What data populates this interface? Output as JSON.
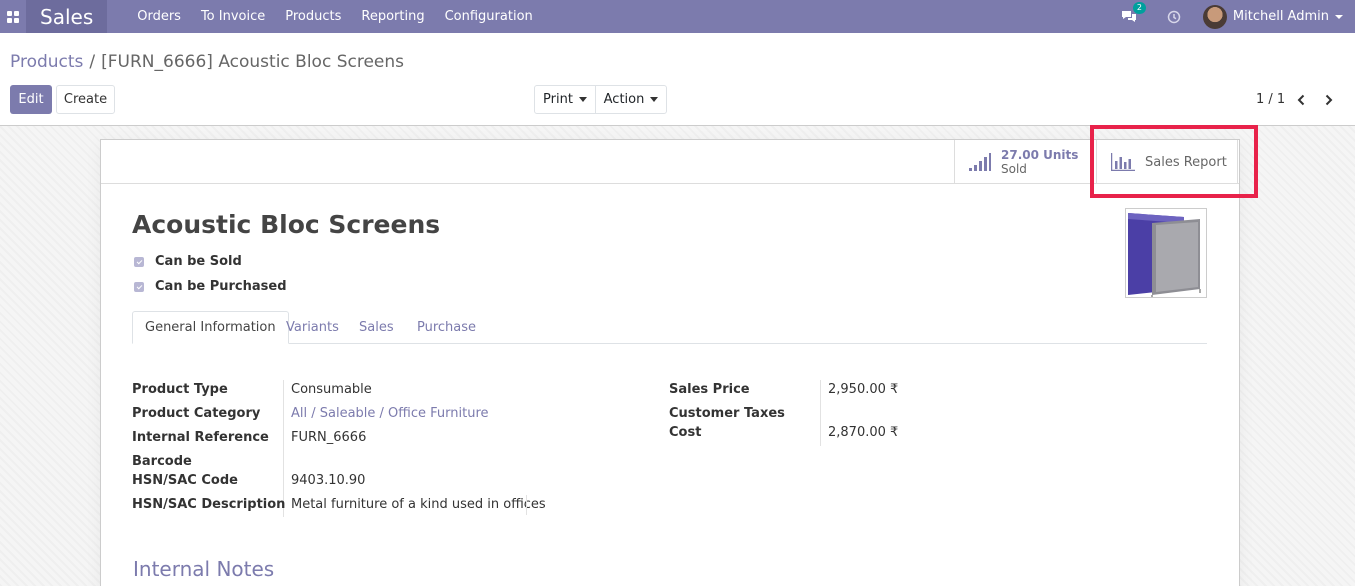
{
  "nav": {
    "brand": "Sales",
    "menu": [
      "Orders",
      "To Invoice",
      "Products",
      "Reporting",
      "Configuration"
    ],
    "chat_count": "2",
    "user": "Mitchell Admin"
  },
  "breadcrumb": {
    "parent": "Products",
    "separator": "/",
    "current": "[FURN_6666] Acoustic Bloc Screens"
  },
  "toolbar": {
    "edit": "Edit",
    "create": "Create",
    "print": "Print",
    "action": "Action"
  },
  "pager": {
    "value": "1 / 1"
  },
  "smart_buttons": {
    "sold_value": "27.00 Units",
    "sold_label": "Sold",
    "report_label": "Sales Report"
  },
  "product": {
    "name": "Acoustic Bloc Screens",
    "can_be_sold": "Can be Sold",
    "can_be_purchased": "Can be Purchased"
  },
  "tabs": [
    "General Information",
    "Variants",
    "Sales",
    "Purchase"
  ],
  "fields_left": {
    "product_type_label": "Product Type",
    "product_type": "Consumable",
    "category_label": "Product Category",
    "category": "All / Saleable / Office Furniture",
    "internal_ref_label": "Internal Reference",
    "internal_ref": "FURN_6666",
    "barcode_label": "Barcode",
    "hsn_code_label": "HSN/SAC Code",
    "hsn_code": "9403.10.90",
    "hsn_desc_label": "HSN/SAC Description",
    "hsn_desc": "Metal furniture of a kind used in offices"
  },
  "fields_right": {
    "sales_price_label": "Sales Price",
    "sales_price": "2,950.00 ₹",
    "customer_taxes_label": "Customer Taxes",
    "cost_label": "Cost",
    "cost": "2,870.00 ₹"
  },
  "notes": {
    "title": "Internal Notes"
  },
  "colors": {
    "primary": "#7c7bad",
    "highlight": "#e8224a",
    "badge": "#00a09d"
  }
}
